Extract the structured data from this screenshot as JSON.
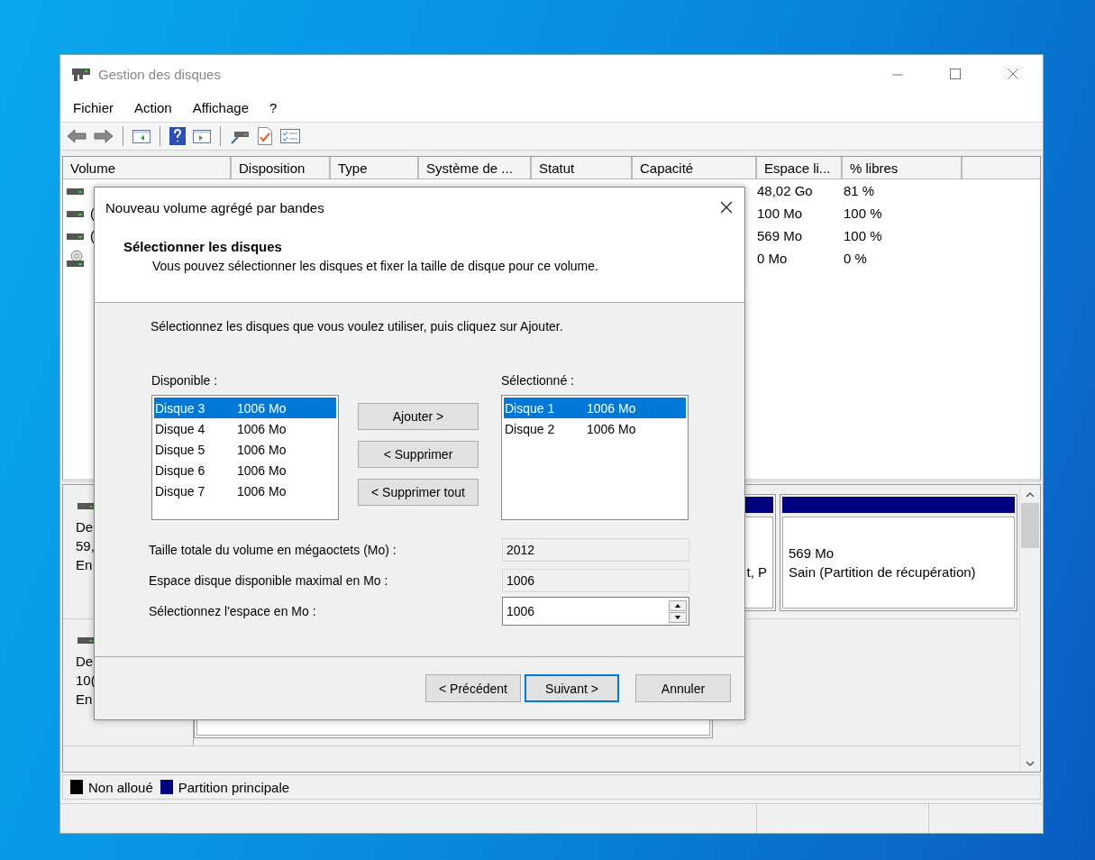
{
  "window": {
    "title": "Gestion des disques"
  },
  "menu": [
    {
      "label": "Fichier"
    },
    {
      "label": "Action"
    },
    {
      "label": "Affichage"
    },
    {
      "label": "?"
    }
  ],
  "volume_table": {
    "columns": [
      "Volume",
      "Disposition",
      "Type",
      "Système de ...",
      "Statut",
      "Capacité",
      "Espace li...",
      "% libres"
    ],
    "rows": [
      {
        "kind": "disk",
        "free_space": "48,02 Go",
        "percent_free": "81 %"
      },
      {
        "kind": "disk",
        "volume": "(",
        "free_space": "100 Mo",
        "percent_free": "100 %"
      },
      {
        "kind": "disk",
        "volume": "(",
        "free_space": "569 Mo",
        "percent_free": "100 %"
      },
      {
        "kind": "optical",
        "free_space": "0 Mo",
        "percent_free": "0 %"
      }
    ]
  },
  "disks": [
    {
      "label_lines": [
        "De",
        "59,",
        "En"
      ],
      "partitions": [
        {
          "kind": "primary",
          "lines": [
            "t, P"
          ]
        },
        {
          "kind": "primary",
          "lines": [
            "569 Mo",
            "Sain (Partition de récupération)"
          ]
        }
      ]
    },
    {
      "label_lines": [
        "De",
        "10(",
        "En"
      ]
    }
  ],
  "legend": [
    {
      "label": "Non alloué",
      "color": "#000000"
    },
    {
      "label": "Partition principale",
      "color": "#000080"
    }
  ],
  "dialog": {
    "title": "Nouveau volume agrégé par bandes",
    "heading": "Sélectionner les disques",
    "subheading": "Vous pouvez sélectionner les disques et fixer la taille de disque pour ce volume.",
    "instruction": "Sélectionnez les disques que vous voulez utiliser, puis cliquez sur Ajouter.",
    "available_label": "Disponible :",
    "available": [
      {
        "name": "Disque 3",
        "size": "1006 Mo",
        "selected": true
      },
      {
        "name": "Disque 4",
        "size": "1006 Mo",
        "selected": false
      },
      {
        "name": "Disque 5",
        "size": "1006 Mo",
        "selected": false
      },
      {
        "name": "Disque 6",
        "size": "1006 Mo",
        "selected": false
      },
      {
        "name": "Disque 7",
        "size": "1006 Mo",
        "selected": false
      }
    ],
    "move_buttons": [
      "Ajouter >",
      "< Supprimer",
      "< Supprimer tout"
    ],
    "selected_label": "Sélectionné :",
    "selected_disks": [
      {
        "name": "Disque 1",
        "size": "1006 Mo",
        "selected": true
      },
      {
        "name": "Disque 2",
        "size": "1006 Mo",
        "selected": false
      }
    ],
    "fields": [
      {
        "label": "Taille totale du volume en mégaoctets (Mo) :",
        "value": "2012",
        "kind": "readonly"
      },
      {
        "label": "Espace disque disponible maximal en Mo :",
        "value": "1006",
        "kind": "readonly"
      },
      {
        "label": "Sélectionnez l'espace en Mo :",
        "value": "1006",
        "kind": "spin"
      }
    ],
    "buttons": [
      {
        "label": "< Précédent",
        "default": false
      },
      {
        "label": "Suivant >",
        "default": true
      },
      {
        "label": "Annuler",
        "default": false
      }
    ]
  }
}
